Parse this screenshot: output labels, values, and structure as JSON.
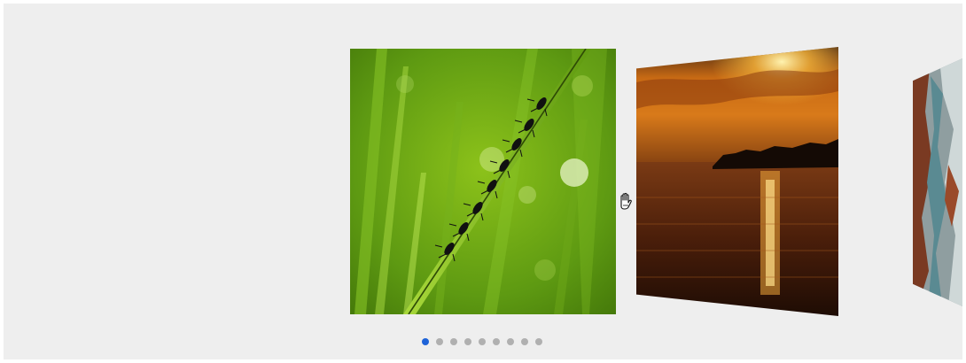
{
  "carousel": {
    "slides": [
      {
        "name": "grass-ants-photo",
        "state": "active"
      },
      {
        "name": "sunset-lake-photo",
        "state": "next"
      },
      {
        "name": "coastal-rocks-photo",
        "state": "far"
      }
    ],
    "pagination": {
      "total": 9,
      "active_index": 0
    },
    "colors": {
      "background": "#eeeeee",
      "dot_active": "#1e63d8",
      "dot_inactive": "#b0b0b0"
    }
  },
  "cursor": {
    "icon": "grab-hand-icon"
  }
}
